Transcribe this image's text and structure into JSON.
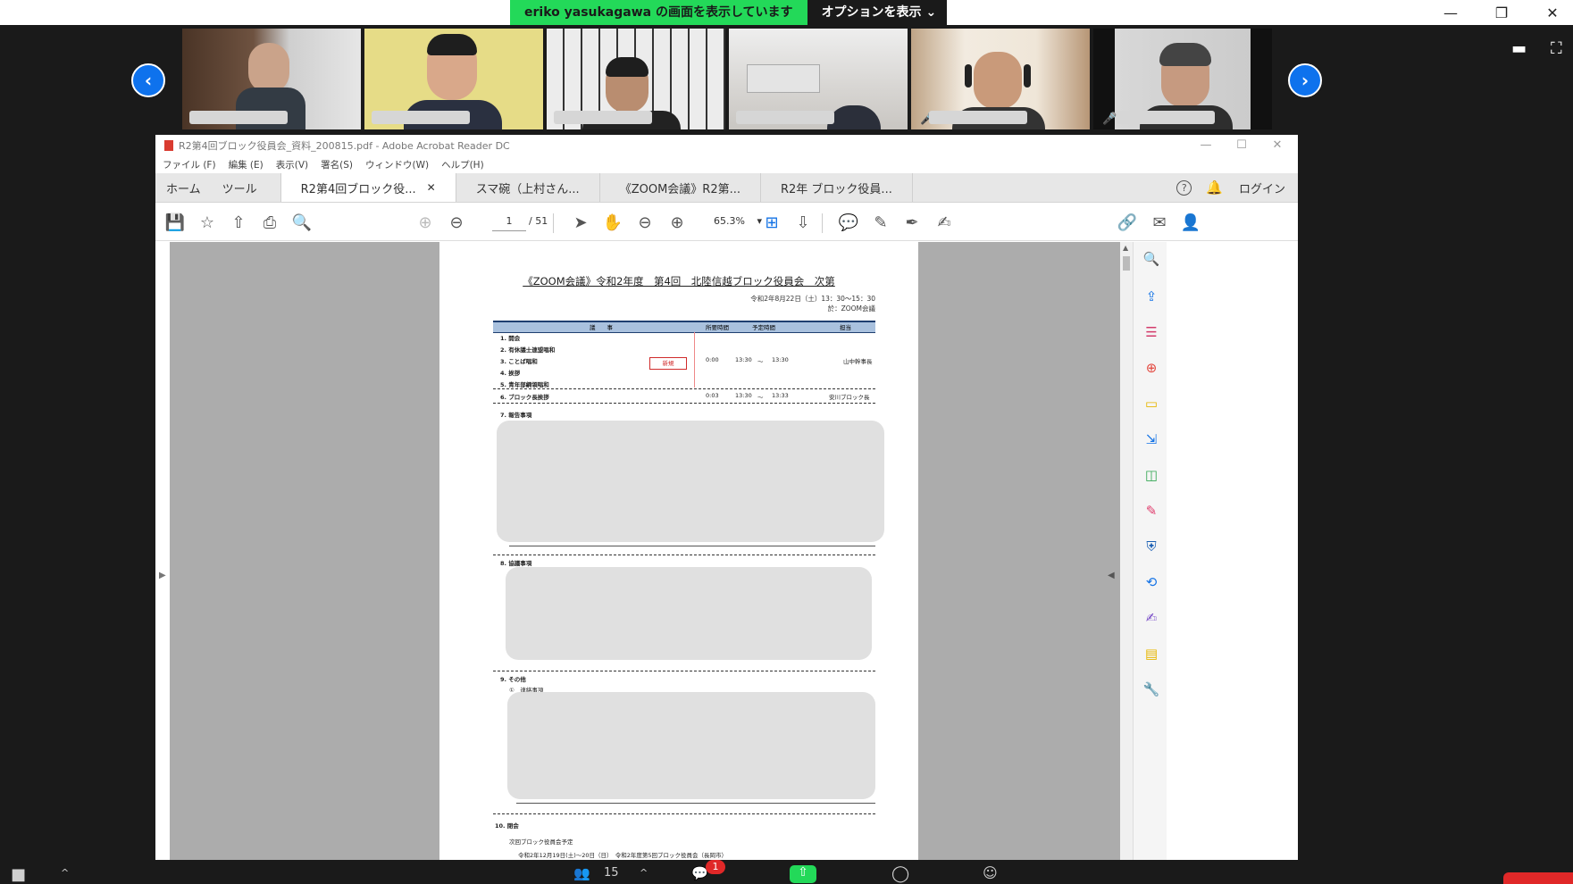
{
  "zoom": {
    "share_banner": "eriko  yasukagawa の画面を表示しています",
    "options_label": "オプションを表示",
    "participants_count": "15",
    "chat_badge": "1"
  },
  "acrobat": {
    "window_title": "R2第4回ブロック役員会_資料_200815.pdf - Adobe Acrobat Reader DC",
    "menu": [
      "ファイル (F)",
      "編集 (E)",
      "表示(V)",
      "署名(S)",
      "ウィンドウ(W)",
      "ヘルプ(H)"
    ],
    "nav_tabs": [
      "ホーム",
      "ツール"
    ],
    "doc_tabs": [
      "R2第4回ブロック役...",
      "スマ碗（上村さん...",
      "《ZOOM会議》R2第...",
      "R2年 ブロック役員..."
    ],
    "login_label": "ログイン",
    "page_current": "1",
    "page_total": "/ 51",
    "zoom_level": "65.3%"
  },
  "document": {
    "title": "《ZOOM会議》令和2年度　第4回　北陸信越ブロック役員会　次第",
    "date_line": "令和2年8月22日（土）13：30〜15：30",
    "venue_line": "於：ZOOM会議",
    "table_headers": [
      "議　　事",
      "所要時間",
      "予定時間",
      "担当"
    ],
    "items": [
      "1. 開会",
      "2. 有休議士連盟唱和",
      "3. ことば唱和",
      "4. 挨拶",
      "5. 青年部綱領唱和",
      "6. ブロック長挨拶",
      "7. 報告事項",
      "8. 協議事項",
      "9. その他",
      "10. 閉会"
    ],
    "new_badge": "新規",
    "row3_duration": "0:00",
    "row3_start": "13:30",
    "row3_sep": "〜",
    "row3_end": "13:30",
    "row3_owner": "山中幹事長",
    "row6_duration": "0:03",
    "row6_start": "13:30",
    "row6_sep": "〜",
    "row6_end": "13:33",
    "row6_owner": "安川ブロック長",
    "sub_item": "①　連絡事項",
    "next_meeting": "次回ブロック役員会予定",
    "next_meeting_detail": "令和2年12月19日(土)〜20日（日）　令和2年度第5回ブロック役員会（長岡市）"
  }
}
